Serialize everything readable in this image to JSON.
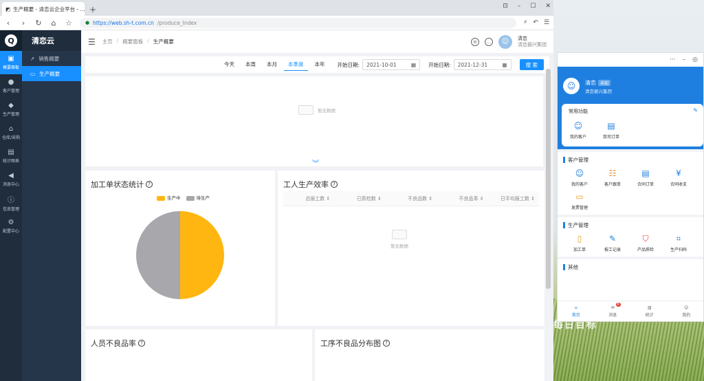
{
  "browser": {
    "tab_title": "生产概要 - 清恋云企业平台 - ...",
    "url_domain": "https://web.sh-t.com.cn",
    "url_path": "/produce_Index"
  },
  "app": {
    "brand": "清恋云",
    "iconbar": [
      {
        "icon": "dashboard-icon",
        "label": "概要面板",
        "active": true
      },
      {
        "icon": "user-icon",
        "label": "客户管理"
      },
      {
        "icon": "cube-icon",
        "label": "生产管理"
      },
      {
        "icon": "warehouse-icon",
        "label": "仓库/采购"
      },
      {
        "icon": "chart-icon",
        "label": "统计图表"
      },
      {
        "icon": "speaker-icon",
        "label": "消息中心"
      },
      {
        "icon": "info-icon",
        "label": "信息管理"
      },
      {
        "icon": "gear-icon",
        "label": "配置中心"
      }
    ],
    "submenu": [
      {
        "label": "销售概要",
        "active": false
      },
      {
        "label": "生产概要",
        "active": true
      }
    ]
  },
  "header": {
    "breadcrumb": [
      "主页",
      "概要面板",
      "生产概要"
    ],
    "user_name": "清恋",
    "user_org": "清恋振兴集团"
  },
  "filter": {
    "ranges": [
      "今天",
      "本周",
      "本月",
      "本季度",
      "本年"
    ],
    "active_range": "本季度",
    "start_label": "开始日期:",
    "start_value": "2021-10-01",
    "end_label": "开始日期:",
    "end_value": "2021-12-31",
    "search_label": "搜 索"
  },
  "empty_text": "暂无数据",
  "panels": {
    "status_title": "加工单状态统计",
    "efficiency_title": "工人生产效率",
    "defect_person_title": "人员不良品率",
    "defect_process_title": "工序不良品分布图",
    "efficiency_columns": [
      "总报工数",
      "已质检数",
      "不良品数",
      "不良品率",
      "日平均报工数"
    ]
  },
  "chart_data": {
    "type": "pie",
    "series": [
      {
        "name": "生产中",
        "value": 50,
        "color": "#FFB611"
      },
      {
        "name": "待生产",
        "value": 50,
        "color": "#A8A7AB"
      }
    ]
  },
  "mobile": {
    "user_name": "清恋",
    "user_tag": "未知",
    "user_org": "清恋振兴集团",
    "common_title": "常用功能",
    "common": [
      {
        "icon": "customer-icon",
        "label": "我的客户"
      },
      {
        "icon": "order-icon",
        "label": "我司订单"
      }
    ],
    "sec1_title": "客户管理",
    "sec1": [
      {
        "icon": "customer-icon",
        "label": "我的客户"
      },
      {
        "icon": "customer-follow-icon",
        "label": "客户跟单"
      },
      {
        "icon": "order-icon",
        "label": "合同订单"
      },
      {
        "icon": "yuan-icon",
        "label": "合同收支"
      },
      {
        "icon": "archive-icon",
        "label": "发票管理"
      }
    ],
    "sec2_title": "生产管理",
    "sec2": [
      {
        "icon": "doc-icon",
        "label": "加工单"
      },
      {
        "icon": "report-icon",
        "label": "报工记录"
      },
      {
        "icon": "shield-icon",
        "label": "产品质检"
      },
      {
        "icon": "scan-icon",
        "label": "生产扫码"
      }
    ],
    "sec3_title": "其他",
    "tabs": [
      {
        "icon": "home-icon",
        "label": "首页",
        "active": true
      },
      {
        "icon": "message-icon",
        "label": "消息",
        "badge": "8"
      },
      {
        "icon": "stats-icon",
        "label": "统计"
      },
      {
        "icon": "profile-icon",
        "label": "我的"
      }
    ]
  },
  "desktop": {
    "watermark": "每日目标"
  }
}
